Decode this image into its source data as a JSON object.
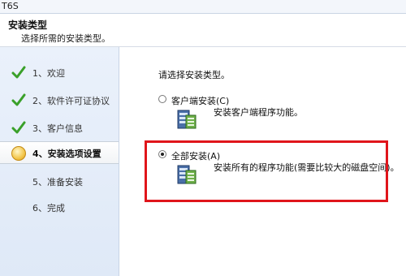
{
  "window": {
    "title": "T6S"
  },
  "header": {
    "title": "安装类型",
    "subtitle": "选择所需的安装类型。"
  },
  "sidebar": {
    "steps": [
      {
        "label": "1、欢迎",
        "status": "done",
        "icon": "check-icon"
      },
      {
        "label": "2、软件许可证协议",
        "status": "done",
        "icon": "check-icon"
      },
      {
        "label": "3、客户信息",
        "status": "done",
        "icon": "check-icon"
      },
      {
        "label": "4、安装选项设置",
        "status": "current",
        "icon": "bulb-icon"
      },
      {
        "label": "5、准备安装",
        "status": "pending",
        "icon": ""
      },
      {
        "label": "6、完成",
        "status": "pending",
        "icon": ""
      }
    ]
  },
  "main": {
    "prompt": "请选择安装类型。",
    "options": [
      {
        "label": "客户端安装(C)",
        "description": "安装客户端程序功能。",
        "selected": false
      },
      {
        "label": "全部安装(A)",
        "description": "安装所有的程序功能(需要比较大的磁盘空间)。",
        "selected": true
      }
    ]
  },
  "colors": {
    "highlight_box": "#e0151b",
    "check_green": "#3aa02a",
    "sidebar_bg": "#e4edf9"
  }
}
